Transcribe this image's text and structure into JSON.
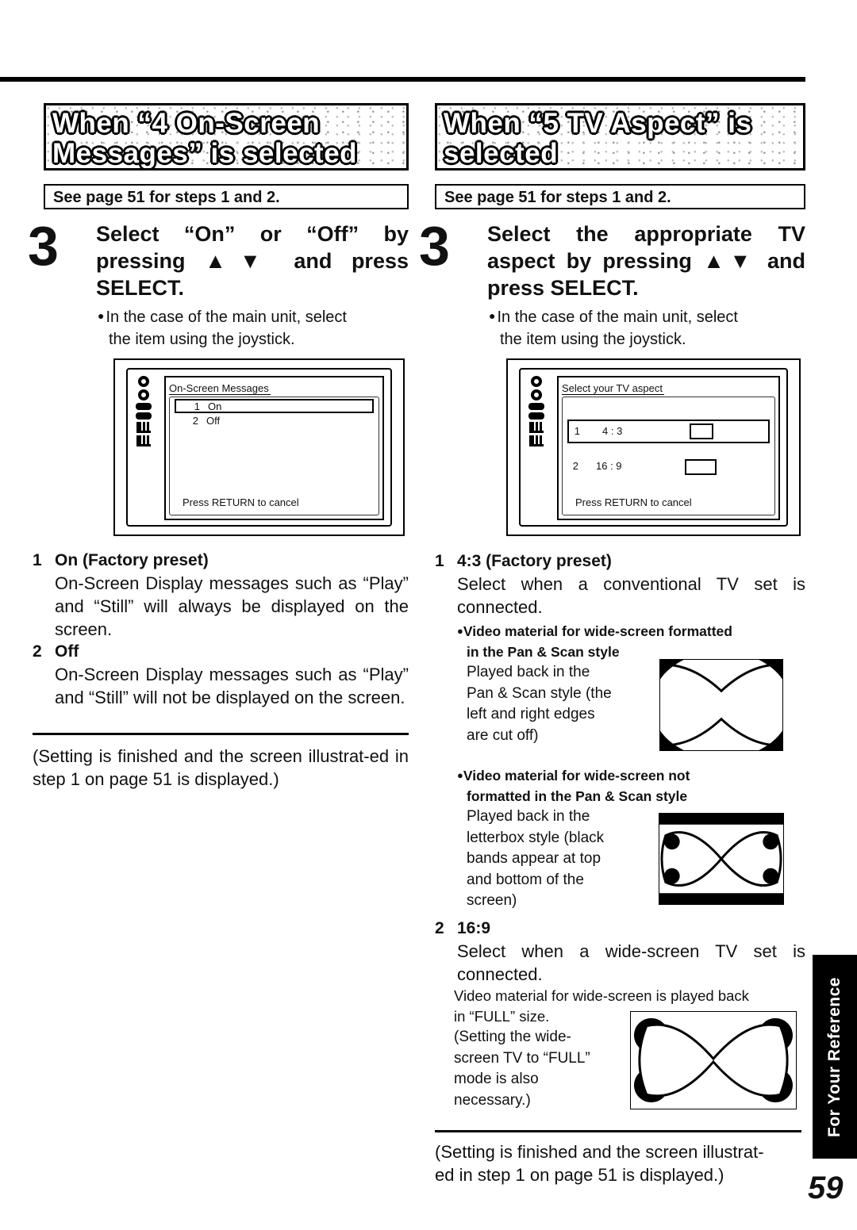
{
  "page": {
    "number": "59",
    "side_tab": "For Your Reference"
  },
  "left": {
    "banner": {
      "line1": "When “4 On-Screen",
      "line2": "Messages” is selected"
    },
    "see_page": "See page 51 for steps 1 and 2.",
    "step": {
      "number": "3",
      "title": "Select “On” or “Off” by pressing ▲▼ and press SELECT.",
      "note_bullet": "●",
      "note_line1": "In the case of the main unit, select",
      "note_line2": "the item using the joystick."
    },
    "osd": {
      "title": "On-Screen Messages",
      "items": [
        {
          "num": "1",
          "label": "On",
          "selected": true
        },
        {
          "num": "2",
          "label": "Off",
          "selected": false
        }
      ],
      "footer": "Press RETURN to cancel"
    },
    "options": [
      {
        "num": "1",
        "label": "On (Factory preset)",
        "body": "On-Screen Display messages such as “Play” and “Still” will always be displayed on the screen."
      },
      {
        "num": "2",
        "label": "Off",
        "body": "On-Screen Display messages such as “Play” and “Still” will not be displayed on the screen."
      }
    ],
    "closing": "(Setting is finished and the screen illustrat-ed in step 1 on page 51 is displayed.)"
  },
  "right": {
    "banner": {
      "line1": "When “5 TV Aspect” is",
      "line2": "selected"
    },
    "see_page": "See page 51 for steps 1 and 2.",
    "step": {
      "number": "3",
      "title": "Select the appropriate TV aspect by pressing ▲▼ and press SELECT.",
      "note_bullet": "●",
      "note_line1": "In the case of the main unit, select",
      "note_line2": "the item using the joystick."
    },
    "osd": {
      "title": "Select your TV aspect",
      "items": [
        {
          "num": "1",
          "label": "4 : 3",
          "selected": true
        },
        {
          "num": "2",
          "label": "16 : 9",
          "selected": false
        }
      ],
      "footer": "Press RETURN to cancel"
    },
    "option1": {
      "num": "1",
      "label": "4:3 (Factory preset)",
      "body": "Select when a conventional TV set is connected.",
      "sub1": {
        "bullet": "●",
        "title_line1": "Video material for wide-screen formatted",
        "title_line2": "in the Pan & Scan style",
        "desc": [
          "Played back in the",
          "Pan & Scan style (the",
          "left and right edges",
          "are cut off)"
        ]
      },
      "sub2": {
        "bullet": "●",
        "title_line1": "Video material for wide-screen not",
        "title_line2": "formatted in the Pan & Scan style",
        "desc": [
          "Played back in the",
          "letterbox style (black",
          "bands appear at top",
          "and bottom of the",
          "screen)"
        ]
      }
    },
    "option2": {
      "num": "2",
      "label": "16:9",
      "body": "Select when a wide-screen TV set is connected.",
      "detail": "Video material for wide-screen is played back",
      "detail2": "in “FULL” size.",
      "desc": [
        "(Setting the wide-",
        "screen TV to “FULL”",
        "mode is also",
        "necessary.)"
      ]
    },
    "closing_line1": "(Setting is finished and the screen illustrat-",
    "closing_line2": "ed in step 1 on page 51 is displayed.)"
  }
}
